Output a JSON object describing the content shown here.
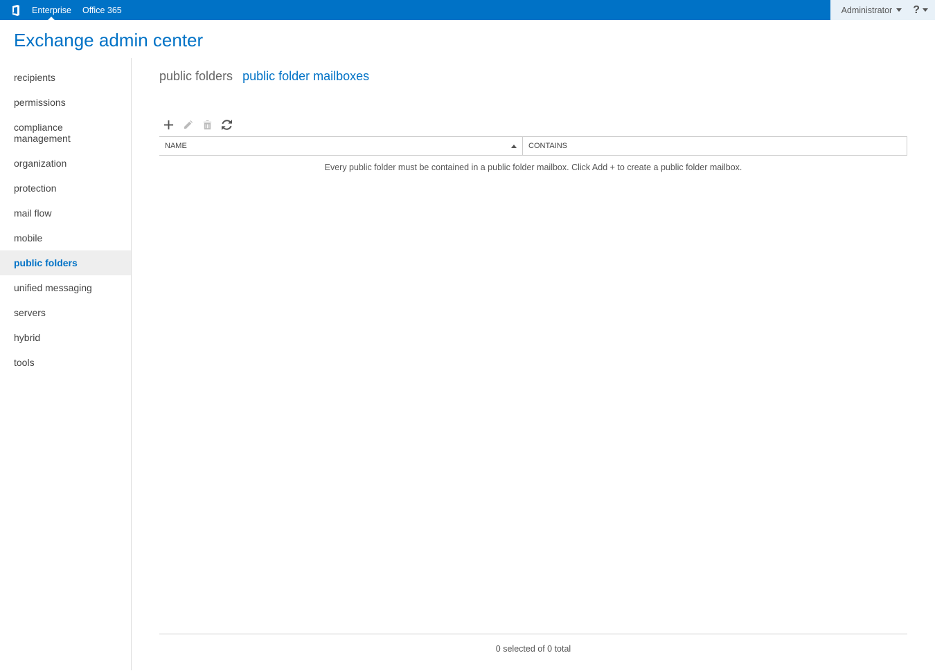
{
  "topbar": {
    "enterprise": "Enterprise",
    "office365": "Office 365",
    "user": "Administrator"
  },
  "page": {
    "title": "Exchange admin center"
  },
  "sidebar": {
    "items": [
      {
        "label": "recipients"
      },
      {
        "label": "permissions"
      },
      {
        "label": "compliance management"
      },
      {
        "label": "organization"
      },
      {
        "label": "protection"
      },
      {
        "label": "mail flow"
      },
      {
        "label": "mobile"
      },
      {
        "label": "public folders"
      },
      {
        "label": "unified messaging"
      },
      {
        "label": "servers"
      },
      {
        "label": "hybrid"
      },
      {
        "label": "tools"
      }
    ]
  },
  "tabs": {
    "public_folders": "public folders",
    "public_folder_mailboxes": "public folder mailboxes"
  },
  "table": {
    "col_name": "NAME",
    "col_contains": "CONTAINS",
    "empty_message": "Every public folder must be contained in a public folder mailbox. Click Add + to create a public folder mailbox.",
    "status": "0 selected of 0 total"
  }
}
